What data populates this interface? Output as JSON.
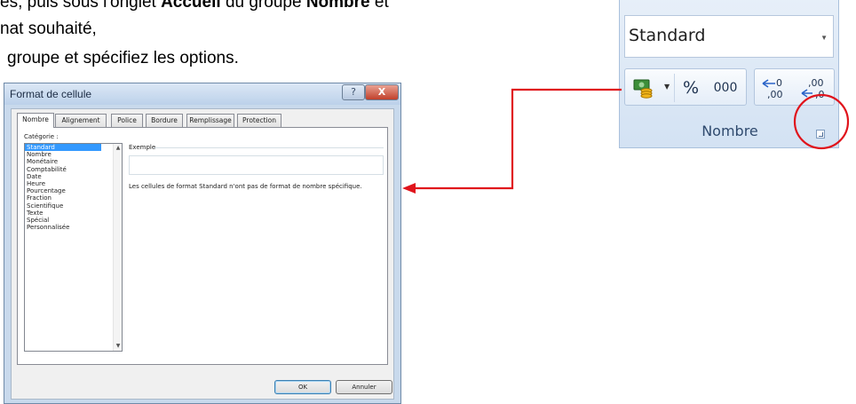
{
  "document": {
    "line1_normal": "es, puis sous l'onglet ",
    "line1_bold1": "Accueil",
    "line1_normal2": " du groupe ",
    "line1_bold2": "Nombre",
    "line1_normal3": " et",
    "line2": "nat souhaité,",
    "line3": "groupe et spécifiez les options."
  },
  "dialog": {
    "title": "Format de cellule",
    "help_glyph": "?",
    "close_glyph": "X",
    "tabs": [
      "Nombre",
      "Alignement",
      "Police",
      "Bordure",
      "Remplissage",
      "Protection"
    ],
    "category_label": "Catégorie :",
    "categories": [
      "Standard",
      "Nombre",
      "Monétaire",
      "Comptabilité",
      "Date",
      "Heure",
      "Pourcentage",
      "Fraction",
      "Scientifique",
      "Texte",
      "Spécial",
      "Personnalisée"
    ],
    "selected_category": "Standard",
    "example_label": "Exemple",
    "description": "Les cellules de format Standard n'ont pas de format de nombre spécifique.",
    "ok_label": "OK",
    "cancel_label": "Annuler"
  },
  "ribbon": {
    "format_value": "Standard",
    "percent_label": "%",
    "thousands_label": "000",
    "group_label": "Nombre",
    "icons": [
      "currency-icon",
      "increase-decimal-icon",
      "decrease-decimal-icon",
      "dialog-launcher-icon"
    ]
  },
  "annotations": {
    "arrow_color": "#e0141c",
    "circle_color": "#e0141c"
  }
}
